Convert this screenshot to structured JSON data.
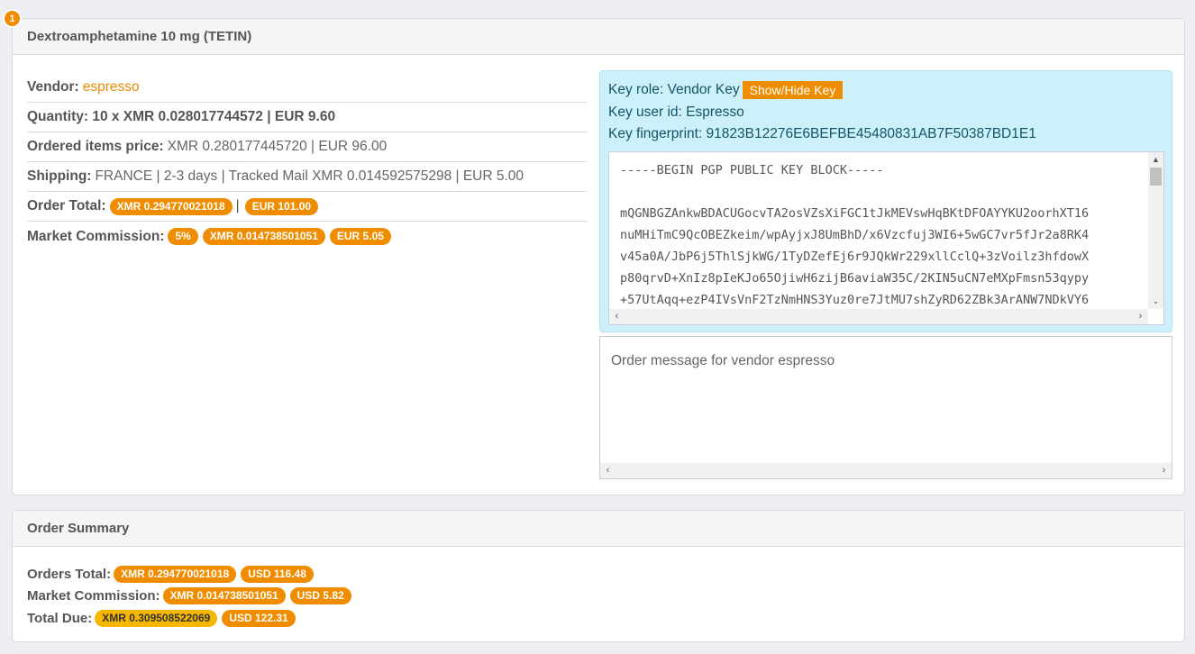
{
  "order": {
    "badge": "1",
    "title": "Dextroamphetamine 10 mg (TETIN)",
    "vendor_label": "Vendor:",
    "vendor_name": "espresso",
    "quantity_text": "Quantity: 10 x XMR 0.028017744572 | EUR 9.60",
    "ordered_price_label": "Ordered items price:",
    "ordered_price_value": "XMR 0.280177445720 | EUR 96.00",
    "shipping_label": "Shipping:",
    "shipping_value": "FRANCE | 2-3 days | Tracked Mail XMR 0.014592575298 | EUR 5.00",
    "order_total_label": "Order Total:",
    "order_total_xmr": "XMR 0.294770021018",
    "order_total_sep": "|",
    "order_total_eur": "EUR 101.00",
    "commission_label": "Market Commission:",
    "commission_pct": "5%",
    "commission_xmr": "XMR 0.014738501051",
    "commission_eur": "EUR 5.05"
  },
  "key": {
    "role": "Key role: Vendor Key",
    "show_hide_label": "Show/Hide Key",
    "user_id": "Key user id: Espresso",
    "fingerprint": "Key fingerprint: 91823B12276E6BEFBE45480831AB7F50387BD1E1",
    "pgp_block": "-----BEGIN PGP PUBLIC KEY BLOCK-----\n\nmQGNBGZAnkwBDACUGocvTA2osVZsXiFGC1tJkMEVswHqBKtDFOAYYKU2oorhXT16\nnuMHiTmC9QcOBEZkeim/wpAyjxJ8UmBhD/x6Vzcfuj3WI6+5wGC7vr5fJr2a8RK4\nv45a0A/JbP6j5ThlSjkWG/1TyDZefEj6r9JQkWr229xllCclQ+3zVoilz3hfdowX\np80qrvD+XnIz8pIeKJo65OjiwH6zijB6aviaW35C/2KIN5uCN7eMXpFmsn53qypy\n+57UtAqq+ezP4IVsVnF2TzNmHNS3Yuz0re7JtMU7shZyRD62ZBk3ArANW7NDkVY6"
  },
  "message": {
    "placeholder": "Order message for vendor espresso"
  },
  "summary": {
    "title": "Order Summary",
    "orders_total_label": "Orders Total:",
    "orders_total_xmr": "XMR 0.294770021018",
    "orders_total_usd": "USD 116.48",
    "commission_label": "Market Commission:",
    "commission_xmr": "XMR 0.014738501051",
    "commission_usd": "USD 5.82",
    "total_due_label": "Total Due:",
    "total_due_xmr": "XMR 0.309508522069",
    "total_due_usd": "USD 122.31"
  },
  "colors": {
    "accent": "#f08c00",
    "highlight": "#f5b700",
    "key_bg": "#cdf1fa"
  }
}
